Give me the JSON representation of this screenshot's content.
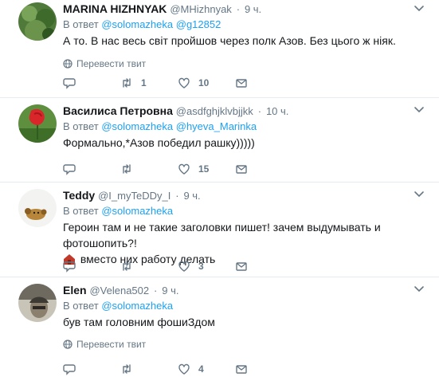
{
  "translate_label": "Перевести твит",
  "reply_prefix": "В ответ",
  "tweets": [
    {
      "name": "MARINA HIZHNYAK",
      "handle": "@MHizhnyak",
      "time": "9 ч.",
      "mentions": [
        "@solomazheka",
        "@g12852"
      ],
      "text": "А то. В нас весь світ пройшов через полк Азов.  Без цього ж ніяк.",
      "replies": "",
      "retweets": "1",
      "likes": "10"
    },
    {
      "name": "Василиса Петровна",
      "handle": "@asdfghjklvbjjkk",
      "time": "10 ч.",
      "mentions": [
        "@solomazheka",
        "@hyeva_Marinka"
      ],
      "text": "Формально,*Азов победил рашку)))))",
      "replies": "",
      "retweets": "",
      "likes": "15"
    },
    {
      "name": "Teddy",
      "handle": "@I_myTeDDy_I",
      "time": "9 ч.",
      "mentions": [
        "@solomazheka"
      ],
      "text_line1": "Героин там и не такие заголовки пишет! зачем выдумывать и фотошопить?!",
      "text_line2": "вместо них работу делать",
      "replies": "",
      "retweets": "",
      "likes": "3"
    },
    {
      "name": "Elen",
      "handle": "@Velena502",
      "time": "9 ч.",
      "mentions": [
        "@solomazheka"
      ],
      "text": "був там головним фошиЗдом",
      "replies": "",
      "retweets": "",
      "likes": "4"
    }
  ],
  "icons": {
    "reply": "reply-icon",
    "retweet": "retweet-icon",
    "like": "heart-icon",
    "dm": "envelope-icon",
    "more": "chevron-down-icon",
    "translate": "globe-icon"
  },
  "colors": {
    "link": "#1da1f2",
    "muted": "#657786",
    "text": "#14171a",
    "border": "#e6ecf0"
  }
}
